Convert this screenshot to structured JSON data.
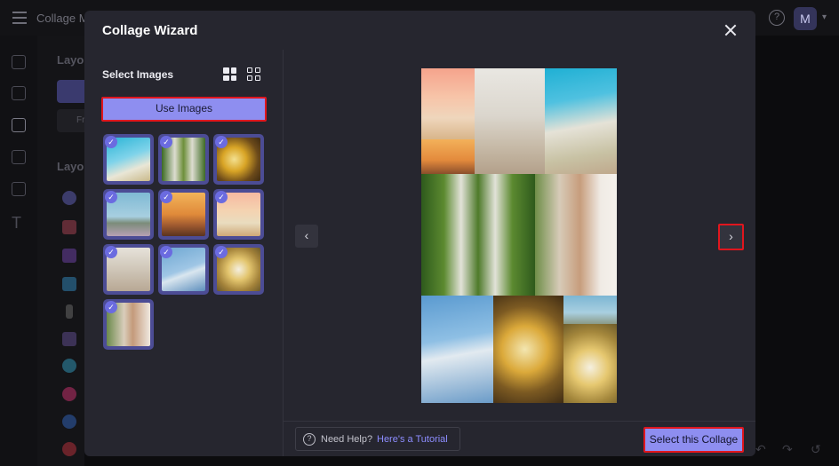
{
  "app": {
    "title": "Collage M",
    "avatar_initial": "M",
    "panel_labels": [
      "Layo",
      "Layo"
    ],
    "panel_button_text": "Fr"
  },
  "modal": {
    "title": "Collage Wizard",
    "close_icon": "close-icon"
  },
  "left_pane": {
    "section_title": "Select Images",
    "view_options": [
      "grid-large-icon",
      "grid-small-icon"
    ],
    "use_images_label": "Use Images",
    "thumbnails": [
      {
        "name": "camera-sky",
        "selected": true
      },
      {
        "name": "feet-grass",
        "selected": true
      },
      {
        "name": "sunflowers",
        "selected": true
      },
      {
        "name": "beach-birds",
        "selected": true
      },
      {
        "name": "sunset-birds",
        "selected": true
      },
      {
        "name": "palm-tree",
        "selected": true
      },
      {
        "name": "woman-beach",
        "selected": true
      },
      {
        "name": "polaroid-sky",
        "selected": true
      },
      {
        "name": "daisies",
        "selected": true
      },
      {
        "name": "woman-scarf",
        "selected": true
      }
    ]
  },
  "preview": {
    "prev_icon": "chevron-left-icon",
    "next_icon": "chevron-right-icon"
  },
  "footer": {
    "help_text": "Need Help?",
    "tutorial_link": "Here's a Tutorial",
    "select_label": "Select this Collage"
  },
  "colors": {
    "accent": "#8e8ef0",
    "highlight_border": "#e0161e",
    "modal_bg": "#26262f"
  }
}
